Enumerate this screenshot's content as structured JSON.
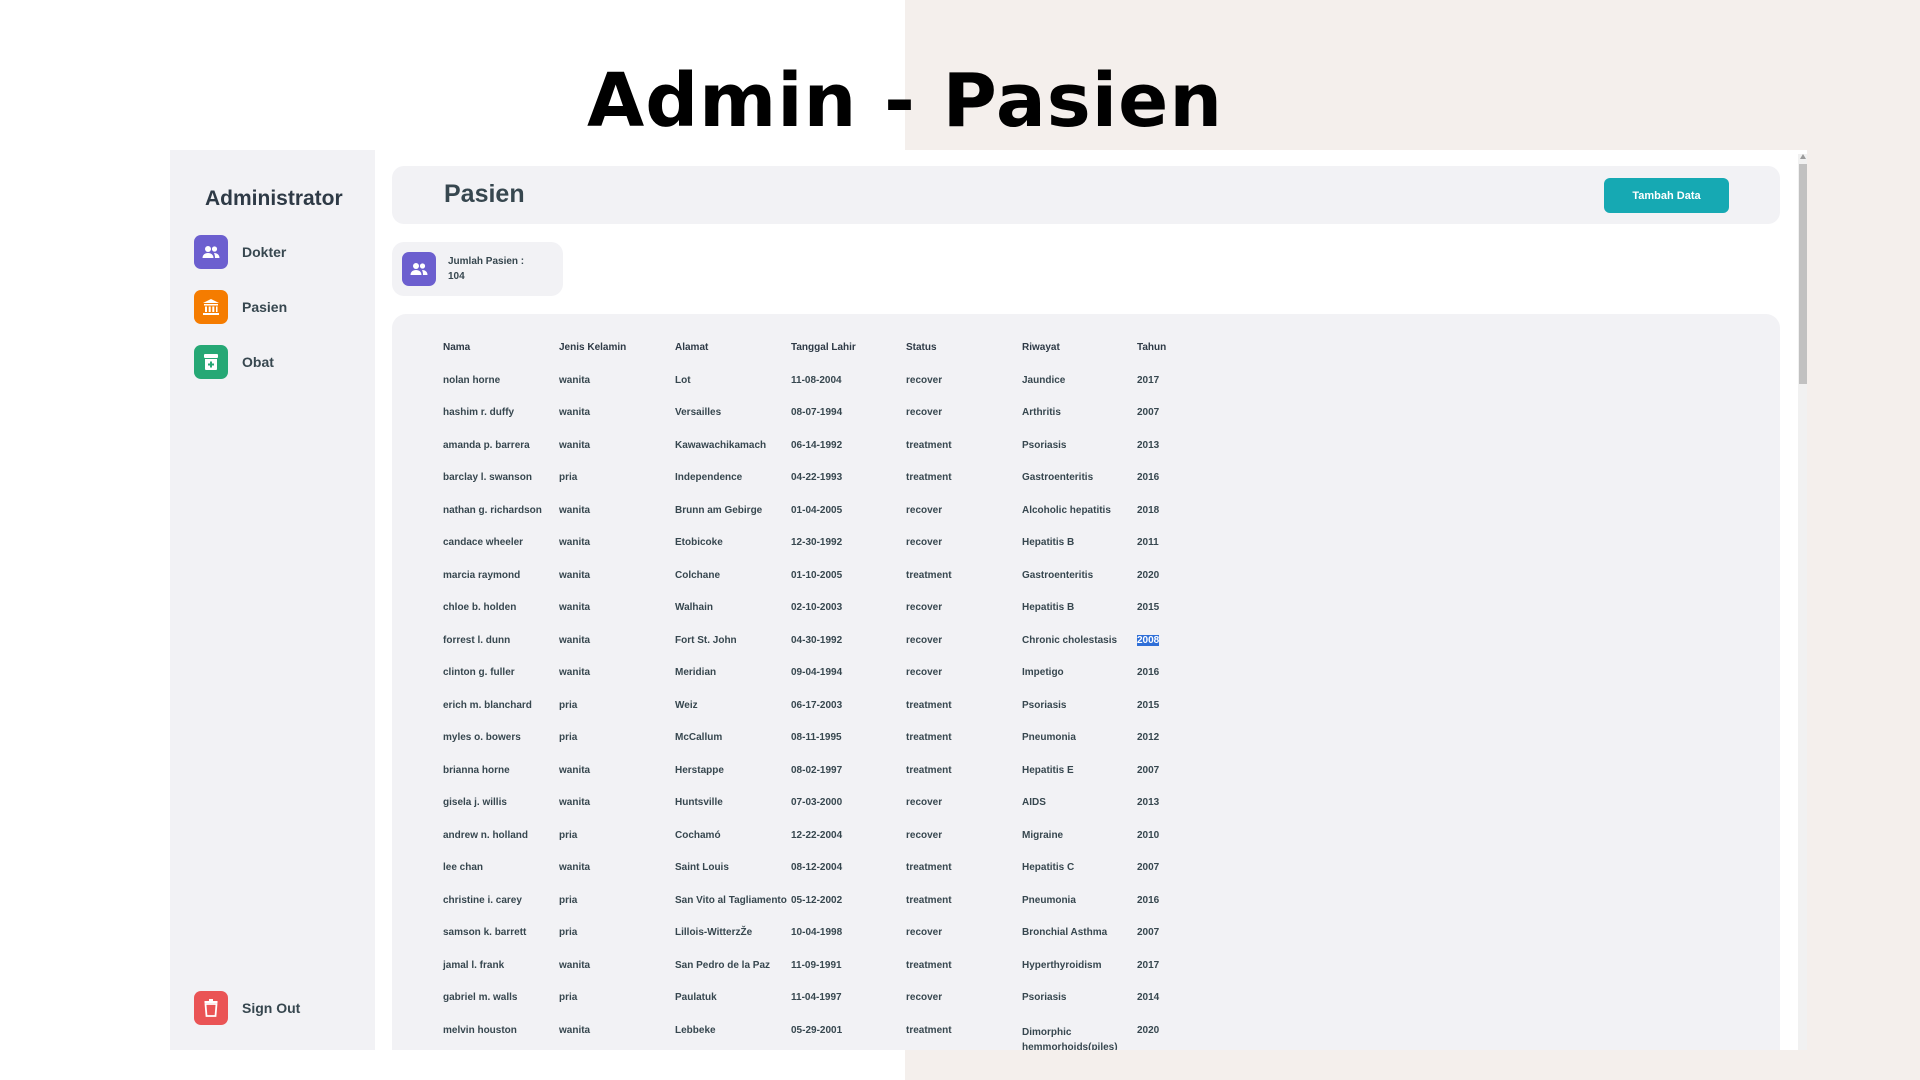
{
  "slide": {
    "title": "Admin - Pasien"
  },
  "sidebar": {
    "title": "Administrator",
    "items": [
      {
        "label": "Dokter",
        "icon": "users-icon",
        "color": "#6c5fcf"
      },
      {
        "label": "Pasien",
        "icon": "bank-icon",
        "color": "#f57c00"
      },
      {
        "label": "Obat",
        "icon": "medicine-icon",
        "color": "#26a875"
      }
    ],
    "signout": {
      "label": "Sign Out",
      "icon": "trash-icon",
      "color": "#ea5455"
    }
  },
  "header": {
    "title": "Pasien",
    "add_button": "Tambah Data"
  },
  "count_card": {
    "label": "Jumlah Pasien :",
    "value": "104"
  },
  "table": {
    "columns": [
      "Nama",
      "Jenis Kelamin",
      "Alamat",
      "Tanggal Lahir",
      "Status",
      "Riwayat",
      "Tahun"
    ],
    "rows": [
      [
        "nolan horne",
        "wanita",
        "Lot",
        "11-08-2004",
        "recover",
        "Jaundice",
        "2017"
      ],
      [
        "hashim r. duffy",
        "wanita",
        "Versailles",
        "08-07-1994",
        "recover",
        "Arthritis",
        "2007"
      ],
      [
        "amanda p. barrera",
        "wanita",
        "Kawawachikamach",
        "06-14-1992",
        "treatment",
        "Psoriasis",
        "2013"
      ],
      [
        "barclay l. swanson",
        "pria",
        "Independence",
        "04-22-1993",
        "treatment",
        "Gastroenteritis",
        "2016"
      ],
      [
        "nathan g. richardson",
        "wanita",
        "Brunn am Gebirge",
        "01-04-2005",
        "recover",
        "Alcoholic hepatitis",
        "2018"
      ],
      [
        "candace wheeler",
        "wanita",
        "Etobicoke",
        "12-30-1992",
        "recover",
        "Hepatitis B",
        "2011"
      ],
      [
        "marcia raymond",
        "wanita",
        "Colchane",
        "01-10-2005",
        "treatment",
        "Gastroenteritis",
        "2020"
      ],
      [
        "chloe b. holden",
        "wanita",
        "Walhain",
        "02-10-2003",
        "recover",
        "Hepatitis B",
        "2015"
      ],
      [
        "forrest l. dunn",
        "wanita",
        "Fort St. John",
        "04-30-1992",
        "recover",
        "Chronic cholestasis",
        "2008"
      ],
      [
        "clinton g. fuller",
        "wanita",
        "Meridian",
        "09-04-1994",
        "recover",
        "Impetigo",
        "2016"
      ],
      [
        "erich m. blanchard",
        "pria",
        "Weiz",
        "06-17-2003",
        "treatment",
        "Psoriasis",
        "2015"
      ],
      [
        "myles o. bowers",
        "pria",
        "McCallum",
        "08-11-1995",
        "treatment",
        "Pneumonia",
        "2012"
      ],
      [
        "brianna horne",
        "wanita",
        "Herstappe",
        "08-02-1997",
        "treatment",
        "Hepatitis E",
        "2007"
      ],
      [
        "gisela j. willis",
        "wanita",
        "Huntsville",
        "07-03-2000",
        "recover",
        "AIDS",
        "2013"
      ],
      [
        "andrew n. holland",
        "pria",
        "Cochamó",
        "12-22-2004",
        "recover",
        "Migraine",
        "2010"
      ],
      [
        "lee chan",
        "wanita",
        "Saint Louis",
        "08-12-2004",
        "treatment",
        "Hepatitis C",
        "2007"
      ],
      [
        "christine i. carey",
        "pria",
        "San Vito al Tagliamento",
        "05-12-2002",
        "treatment",
        "Pneumonia",
        "2016"
      ],
      [
        "samson k. barrett",
        "pria",
        "Lillois-WitterzŽe",
        "10-04-1998",
        "recover",
        "Bronchial Asthma",
        "2007"
      ],
      [
        "jamal l. frank",
        "wanita",
        "San Pedro de la Paz",
        "11-09-1991",
        "treatment",
        "Hyperthyroidism",
        "2017"
      ],
      [
        "gabriel m. walls",
        "pria",
        "Paulatuk",
        "11-04-1997",
        "recover",
        "Psoriasis",
        "2014"
      ],
      [
        "melvin houston",
        "wanita",
        "Lebbeke",
        "05-29-2001",
        "treatment",
        "Dimorphic hemmorhoids(piles)",
        "2020"
      ]
    ],
    "selected_cell": {
      "row": 8,
      "col": 6
    }
  }
}
